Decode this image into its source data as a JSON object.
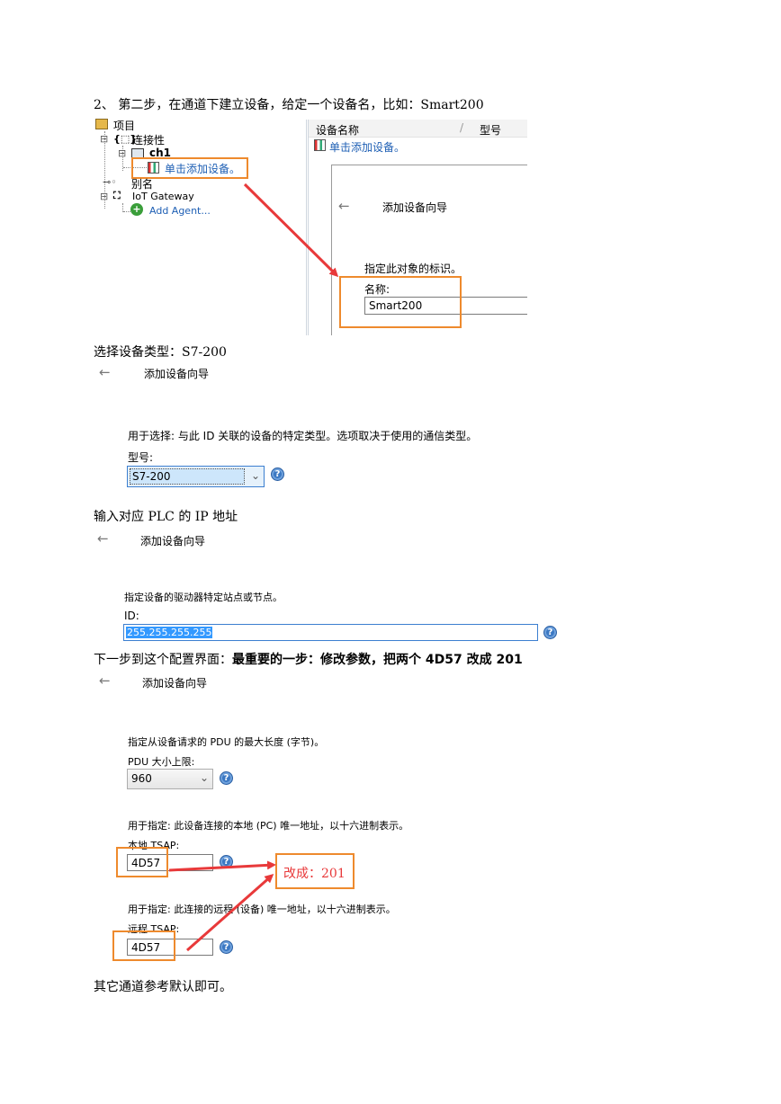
{
  "step2": {
    "heading": "2、 第二步，在通道下建立设备，给定一个设备名，比如：Smart200",
    "tree": {
      "project": "项目",
      "connectivity": "连接性",
      "channel": "ch1",
      "add_device": "单击添加设备。",
      "alias": "别名",
      "iot_gateway": "IoT Gateway",
      "add_agent": "Add Agent..."
    },
    "table": {
      "col_device_name": "设备名称",
      "col_model": "型号",
      "add_device": "单击添加设备。"
    },
    "wizard": {
      "back_icon": "←",
      "title": "添加设备向导",
      "desc": "指定此对象的标识。",
      "name_label": "名称:",
      "name_value": "Smart200"
    }
  },
  "device_type": {
    "caption": "选择设备类型：S7-200",
    "back_icon": "←",
    "title": "添加设备向导",
    "desc": "用于选择: 与此 ID 关联的设备的特定类型。选项取决于使用的通信类型。",
    "model_label": "型号:",
    "model_value": "S7-200",
    "help": "?"
  },
  "ip_step": {
    "caption": "输入对应 PLC 的 IP 地址",
    "back_icon": "←",
    "title": "添加设备向导",
    "desc": "指定设备的驱动器特定站点或节点。",
    "id_label": "ID:",
    "id_value": "255.255.255.255",
    "help": "?"
  },
  "config_step": {
    "caption_normal": "下一步到这个配置界面：",
    "caption_bold": "最重要的一步：修改参数，把两个 4D57 改成 201",
    "back_icon": "←",
    "title": "添加设备向导",
    "pdu_desc": "指定从设备请求的  PDU 的最大长度 (字节)。",
    "pdu_label": "PDU 大小上限:",
    "pdu_value": "960",
    "local_desc": "用于指定: 此设备连接的本地 (PC) 唯一地址，以十六进制表示。",
    "local_label": "本地 TSAP:",
    "local_value": "4D57",
    "remote_desc": "用于指定: 此连接的远程 (设备) 唯一地址，以十六进制表示。",
    "remote_label": "远程 TSAP:",
    "remote_value": "4D57",
    "annotation": "改成：201",
    "help": "?"
  },
  "footer": "其它通道参考默认即可。",
  "colors": {
    "accent_orange": "#ee8a2d",
    "arrow_red": "#e8393a",
    "link_blue": "#1e5fb4",
    "select_blue": "#3399ff"
  }
}
